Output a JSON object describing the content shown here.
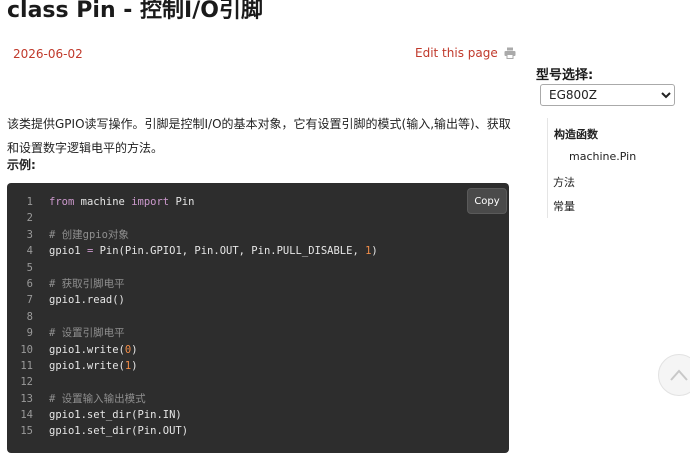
{
  "page": {
    "title": "class Pin - 控制I/O引脚",
    "date": "2026-06-02",
    "edit_label": "Edit this page",
    "intro": "该类提供GPIO读写操作。引脚是控制I/O的基本对象，它有设置引脚的模式(输入,输出等)、获取和设置数字逻辑电平的方法。",
    "example_label": "示例:"
  },
  "code": {
    "copy_label": "Copy",
    "lines": [
      {
        "n": "1",
        "parts": [
          [
            "k",
            "from"
          ],
          [
            "p",
            " machine "
          ],
          [
            "k",
            "import"
          ],
          [
            "p",
            " Pin"
          ]
        ]
      },
      {
        "n": "2",
        "parts": []
      },
      {
        "n": "3",
        "parts": [
          [
            "c",
            "# 创建gpio对象"
          ]
        ]
      },
      {
        "n": "4",
        "parts": [
          [
            "p",
            "gpio1 "
          ],
          [
            "k",
            "="
          ],
          [
            "p",
            " Pin(Pin.GPIO1, Pin.OUT, Pin.PULL_DISABLE, "
          ],
          [
            "n",
            "1"
          ],
          [
            "p",
            ")"
          ]
        ]
      },
      {
        "n": "5",
        "parts": []
      },
      {
        "n": "6",
        "parts": [
          [
            "c",
            "# 获取引脚电平"
          ]
        ]
      },
      {
        "n": "7",
        "parts": [
          [
            "p",
            "gpio1.read()"
          ]
        ]
      },
      {
        "n": "8",
        "parts": []
      },
      {
        "n": "9",
        "parts": [
          [
            "c",
            "# 设置引脚电平"
          ]
        ]
      },
      {
        "n": "10",
        "parts": [
          [
            "p",
            "gpio1.write("
          ],
          [
            "n",
            "0"
          ],
          [
            "p",
            ")"
          ]
        ]
      },
      {
        "n": "11",
        "parts": [
          [
            "p",
            "gpio1.write("
          ],
          [
            "n",
            "1"
          ],
          [
            "p",
            ")"
          ]
        ]
      },
      {
        "n": "12",
        "parts": []
      },
      {
        "n": "13",
        "parts": [
          [
            "c",
            "# 设置输入输出模式"
          ]
        ]
      },
      {
        "n": "14",
        "parts": [
          [
            "p",
            "gpio1.set_dir(Pin.IN)"
          ]
        ]
      },
      {
        "n": "15",
        "parts": [
          [
            "p",
            "gpio1.set_dir(Pin.OUT)"
          ]
        ]
      }
    ]
  },
  "sidebar": {
    "model_label": "型号选择:",
    "model_selected": "EG800Z",
    "toc": [
      {
        "label": "构造函数",
        "bold": true
      },
      {
        "label": "machine.Pin",
        "bold": false
      },
      {
        "label": "方法",
        "bold": false
      },
      {
        "label": "常量",
        "bold": false
      }
    ]
  },
  "colors": {
    "accent": "#c0392b",
    "code_bg": "#2d2d2d",
    "keyword": "#cc99cd",
    "comment": "#8f8f8f",
    "number": "#f08d49"
  },
  "icons": {
    "print": "printer-icon",
    "scroll_top": "chevron-up-icon"
  }
}
